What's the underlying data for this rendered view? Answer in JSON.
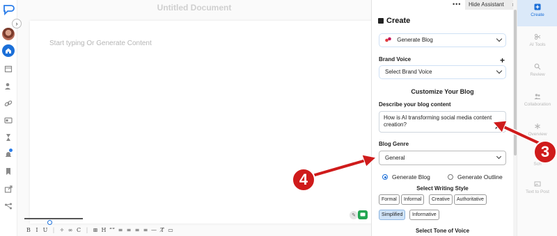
{
  "editor": {
    "doc_title": "Untitled Document",
    "placeholder": "Start typing Or Generate Content",
    "toolbar": [
      "B",
      "I",
      "U",
      "|",
      "✧",
      "∞",
      "C",
      "|",
      "⊞",
      "H",
      "“”",
      "≡",
      "≡",
      "≡",
      "≡",
      "—",
      "T̸",
      "▭"
    ]
  },
  "panel": {
    "hide_label": "Hide Assistant",
    "dots": "•••",
    "create_title": "Create",
    "content_type": "Generate Blog",
    "brand_voice_label": "Brand Voice",
    "brand_voice_plus": "+",
    "brand_voice_value": "Select Brand Voice",
    "customize_title": "Customize Your Blog",
    "describe_label": "Describe your blog content",
    "describe_value": "How is AI transforming social media content creation?",
    "genre_label": "Blog Genre",
    "genre_value": "General",
    "radio_blog": "Generate Blog",
    "radio_outline": "Generate Outline",
    "writing_style_title": "Select Writing Style",
    "styles": [
      "Formal",
      "Informal",
      "Creative",
      "Authoritative",
      "Simplified",
      "Informative"
    ],
    "selected_style": "Simplified",
    "tone_title": "Select Tone of Voice"
  },
  "right_rail": {
    "items": [
      "Create",
      "AI Tools",
      "Review",
      "Collaboration",
      "Overview",
      "Sch",
      "Text to Post"
    ],
    "active": "Create"
  },
  "annotations": {
    "badge_3": "3",
    "badge_4": "4"
  },
  "colors": {
    "accent": "#1b6fd8",
    "annotation_red": "#cf1b1b",
    "selected_chip": "#cfe3f8",
    "green_button": "#22a652"
  }
}
